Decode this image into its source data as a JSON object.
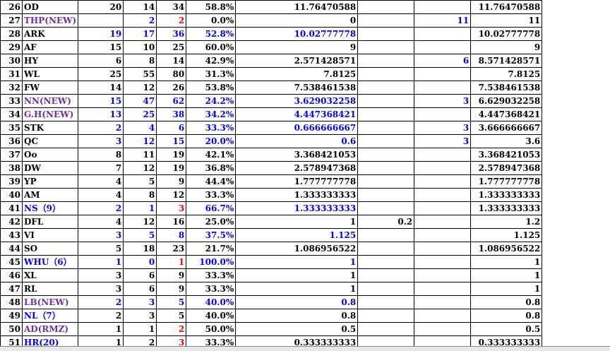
{
  "rows": [
    {
      "rn": "26",
      "name": "OD",
      "nc": "black",
      "a": "20",
      "ac": "black",
      "b": "14",
      "bc": "black",
      "t": "34",
      "tc": "black",
      "p": "58.8%",
      "pcl": "black",
      "d": "11.76470588",
      "dc": "black",
      "e1": "",
      "e1c": "black",
      "e2": "",
      "e2c": "black",
      "tot": "11.76470588"
    },
    {
      "rn": "27",
      "name": "THP(NEW)",
      "nc": "purple",
      "a": "",
      "ac": "black",
      "b": "2",
      "bc": "blue",
      "t": "2",
      "tc": "red",
      "p": "0.0%",
      "pcl": "black",
      "d": "0",
      "dc": "black",
      "e1": "",
      "e1c": "black",
      "e2": "11",
      "e2c": "blue",
      "tot": "11"
    },
    {
      "rn": "28",
      "name": "ARK",
      "nc": "black",
      "a": "19",
      "ac": "blue",
      "b": "17",
      "bc": "blue",
      "t": "36",
      "tc": "blue",
      "p": "52.8%",
      "pcl": "blue",
      "d": "10.02777778",
      "dc": "blue",
      "e1": "",
      "e1c": "black",
      "e2": "",
      "e2c": "black",
      "tot": "10.02777778"
    },
    {
      "rn": "29",
      "name": "AF",
      "nc": "black",
      "a": "15",
      "ac": "black",
      "b": "10",
      "bc": "black",
      "t": "25",
      "tc": "black",
      "p": "60.0%",
      "pcl": "black",
      "d": "9",
      "dc": "black",
      "e1": "",
      "e1c": "black",
      "e2": "",
      "e2c": "black",
      "tot": "9"
    },
    {
      "rn": "30",
      "name": "HY",
      "nc": "black",
      "a": "6",
      "ac": "black",
      "b": "8",
      "bc": "black",
      "t": "14",
      "tc": "black",
      "p": "42.9%",
      "pcl": "black",
      "d": "2.571428571",
      "dc": "black",
      "e1": "",
      "e1c": "black",
      "e2": "6",
      "e2c": "blue",
      "tot": "8.571428571"
    },
    {
      "rn": "31",
      "name": "WL",
      "nc": "black",
      "a": "25",
      "ac": "black",
      "b": "55",
      "bc": "black",
      "t": "80",
      "tc": "black",
      "p": "31.3%",
      "pcl": "black",
      "d": "7.8125",
      "dc": "black",
      "e1": "",
      "e1c": "black",
      "e2": "",
      "e2c": "black",
      "tot": "7.8125"
    },
    {
      "rn": "32",
      "name": "FW",
      "nc": "black",
      "a": "14",
      "ac": "black",
      "b": "12",
      "bc": "black",
      "t": "26",
      "tc": "black",
      "p": "53.8%",
      "pcl": "black",
      "d": "7.538461538",
      "dc": "black",
      "e1": "",
      "e1c": "black",
      "e2": "",
      "e2c": "black",
      "tot": "7.538461538"
    },
    {
      "rn": "33",
      "name": "NN(NEW)",
      "nc": "purple",
      "a": "15",
      "ac": "blue",
      "b": "47",
      "bc": "blue",
      "t": "62",
      "tc": "blue",
      "p": "24.2%",
      "pcl": "blue",
      "d": "3.629032258",
      "dc": "blue",
      "e1": "",
      "e1c": "black",
      "e2": "3",
      "e2c": "blue",
      "tot": "6.629032258"
    },
    {
      "rn": "34",
      "name": "G.H(NEW)",
      "nc": "purple",
      "a": "13",
      "ac": "blue",
      "b": "25",
      "bc": "blue",
      "t": "38",
      "tc": "blue",
      "p": "34.2%",
      "pcl": "blue",
      "d": "4.447368421",
      "dc": "blue",
      "e1": "",
      "e1c": "black",
      "e2": "",
      "e2c": "black",
      "tot": "4.447368421"
    },
    {
      "rn": "35",
      "name": "STK",
      "nc": "black",
      "a": "2",
      "ac": "blue",
      "b": "4",
      "bc": "blue",
      "t": "6",
      "tc": "blue",
      "p": "33.3%",
      "pcl": "blue",
      "d": "0.666666667",
      "dc": "blue",
      "e1": "",
      "e1c": "black",
      "e2": "3",
      "e2c": "blue",
      "tot": "3.666666667"
    },
    {
      "rn": "36",
      "name": "QC",
      "nc": "black",
      "a": "3",
      "ac": "blue",
      "b": "12",
      "bc": "blue",
      "t": "15",
      "tc": "blue",
      "p": "20.0%",
      "pcl": "blue",
      "d": "0.6",
      "dc": "blue",
      "e1": "",
      "e1c": "black",
      "e2": "3",
      "e2c": "blue",
      "tot": "3.6"
    },
    {
      "rn": "37",
      "name": "Oo",
      "nc": "black",
      "a": "8",
      "ac": "black",
      "b": "11",
      "bc": "black",
      "t": "19",
      "tc": "black",
      "p": "42.1%",
      "pcl": "black",
      "d": "3.368421053",
      "dc": "black",
      "e1": "",
      "e1c": "black",
      "e2": "",
      "e2c": "black",
      "tot": "3.368421053"
    },
    {
      "rn": "38",
      "name": "DW",
      "nc": "black",
      "a": "7",
      "ac": "black",
      "b": "12",
      "bc": "black",
      "t": "19",
      "tc": "black",
      "p": "36.8%",
      "pcl": "black",
      "d": "2.578947368",
      "dc": "black",
      "e1": "",
      "e1c": "black",
      "e2": "",
      "e2c": "black",
      "tot": "2.578947368"
    },
    {
      "rn": "39",
      "name": "YP",
      "nc": "black",
      "a": "4",
      "ac": "black",
      "b": "5",
      "bc": "black",
      "t": "9",
      "tc": "black",
      "p": "44.4%",
      "pcl": "black",
      "d": "1.777777778",
      "dc": "black",
      "e1": "",
      "e1c": "black",
      "e2": "",
      "e2c": "black",
      "tot": "1.777777778"
    },
    {
      "rn": "40",
      "name": "AM",
      "nc": "black",
      "a": "4",
      "ac": "black",
      "b": "8",
      "bc": "black",
      "t": "12",
      "tc": "black",
      "p": "33.3%",
      "pcl": "black",
      "d": "1.333333333",
      "dc": "black",
      "e1": "",
      "e1c": "black",
      "e2": "",
      "e2c": "black",
      "tot": "1.333333333"
    },
    {
      "rn": "41",
      "name": "NS（9）",
      "nc": "blue",
      "a": "2",
      "ac": "blue",
      "b": "1",
      "bc": "blue",
      "t": "3",
      "tc": "red",
      "p": "66.7%",
      "pcl": "blue",
      "d": "1.333333333",
      "dc": "blue",
      "e1": "",
      "e1c": "black",
      "e2": "",
      "e2c": "black",
      "tot": "1.333333333"
    },
    {
      "rn": "42",
      "name": "DFL",
      "nc": "black",
      "a": "4",
      "ac": "black",
      "b": "12",
      "bc": "black",
      "t": "16",
      "tc": "black",
      "p": "25.0%",
      "pcl": "black",
      "d": "1",
      "dc": "black",
      "e1": "0.2",
      "e1c": "black",
      "e2": "",
      "e2c": "black",
      "tot": "1.2"
    },
    {
      "rn": "43",
      "name": "VI",
      "nc": "black",
      "a": "3",
      "ac": "blue",
      "b": "5",
      "bc": "blue",
      "t": "8",
      "tc": "blue",
      "p": "37.5%",
      "pcl": "blue",
      "d": "1.125",
      "dc": "blue",
      "e1": "",
      "e1c": "black",
      "e2": "",
      "e2c": "black",
      "tot": "1.125"
    },
    {
      "rn": "44",
      "name": "SO",
      "nc": "black",
      "a": "5",
      "ac": "black",
      "b": "18",
      "bc": "black",
      "t": "23",
      "tc": "black",
      "p": "21.7%",
      "pcl": "black",
      "d": "1.086956522",
      "dc": "black",
      "e1": "",
      "e1c": "black",
      "e2": "",
      "e2c": "black",
      "tot": "1.086956522"
    },
    {
      "rn": "45",
      "name": "WHU（6）",
      "nc": "blue",
      "a": "1",
      "ac": "blue",
      "b": "0",
      "bc": "blue",
      "t": "1",
      "tc": "red",
      "p": "100.0%",
      "pcl": "blue",
      "d": "1",
      "dc": "blue",
      "e1": "",
      "e1c": "black",
      "e2": "",
      "e2c": "black",
      "tot": "1"
    },
    {
      "rn": "46",
      "name": "XL",
      "nc": "black",
      "a": "3",
      "ac": "black",
      "b": "6",
      "bc": "black",
      "t": "9",
      "tc": "black",
      "p": "33.3%",
      "pcl": "black",
      "d": "1",
      "dc": "black",
      "e1": "",
      "e1c": "black",
      "e2": "",
      "e2c": "black",
      "tot": "1"
    },
    {
      "rn": "47",
      "name": "RL",
      "nc": "black",
      "a": "3",
      "ac": "black",
      "b": "6",
      "bc": "black",
      "t": "9",
      "tc": "black",
      "p": "33.3%",
      "pcl": "black",
      "d": "1",
      "dc": "black",
      "e1": "",
      "e1c": "black",
      "e2": "",
      "e2c": "black",
      "tot": "1"
    },
    {
      "rn": "48",
      "name": "LB(NEW)",
      "nc": "purple",
      "a": "2",
      "ac": "blue",
      "b": "3",
      "bc": "blue",
      "t": "5",
      "tc": "blue",
      "p": "40.0%",
      "pcl": "blue",
      "d": "0.8",
      "dc": "blue",
      "e1": "",
      "e1c": "black",
      "e2": "",
      "e2c": "black",
      "tot": "0.8"
    },
    {
      "rn": "49",
      "name": "NL（7）",
      "nc": "blue",
      "a": "2",
      "ac": "black",
      "b": "3",
      "bc": "black",
      "t": "5",
      "tc": "black",
      "p": "40.0%",
      "pcl": "black",
      "d": "0.8",
      "dc": "black",
      "e1": "",
      "e1c": "black",
      "e2": "",
      "e2c": "black",
      "tot": "0.8"
    },
    {
      "rn": "50",
      "name": "AD(RMZ)",
      "nc": "purple",
      "a": "1",
      "ac": "black",
      "b": "1",
      "bc": "black",
      "t": "2",
      "tc": "red",
      "p": "50.0%",
      "pcl": "black",
      "d": "0.5",
      "dc": "black",
      "e1": "",
      "e1c": "black",
      "e2": "",
      "e2c": "black",
      "tot": "0.5"
    },
    {
      "rn": "51",
      "name": "HR(20)",
      "nc": "blue",
      "a": "1",
      "ac": "black",
      "b": "2",
      "bc": "black",
      "t": "3",
      "tc": "red",
      "p": "33.3%",
      "pcl": "black",
      "d": "0.333333333",
      "dc": "black",
      "e1": "",
      "e1c": "black",
      "e2": "",
      "e2c": "black",
      "tot": "0.333333333"
    }
  ]
}
